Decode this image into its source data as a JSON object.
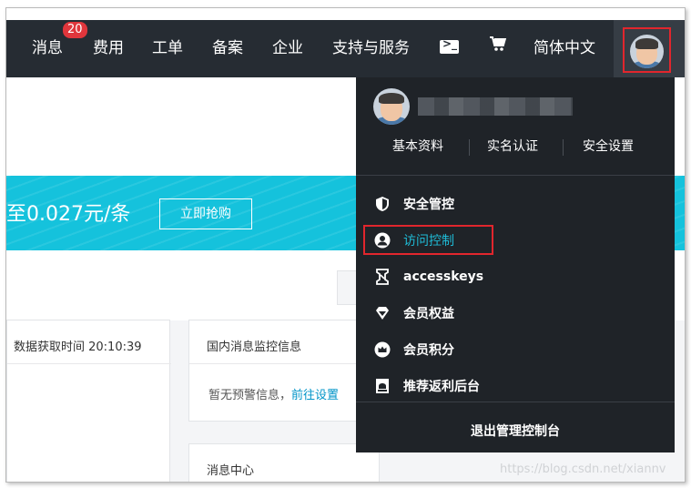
{
  "topnav": {
    "messages_label": "消息",
    "messages_badge": "20",
    "billing_label": "费用",
    "tickets_label": "工单",
    "icp_label": "备案",
    "enterprise_label": "企业",
    "support_label": "支持与服务",
    "language_label": "简体中文"
  },
  "page": {
    "banner_text": "至0.027元/条",
    "buy_button": "立即抢购",
    "data_time_label": "数据获取时间 20:10:39",
    "monitor_title": "国内消息监控信息",
    "monitor_empty": "暂无预警信息，",
    "monitor_link": "前往设置",
    "message_center_title": "消息中心"
  },
  "dropdown": {
    "links": [
      "基本资料",
      "实名认证",
      "安全设置"
    ],
    "items": [
      {
        "label": "安全管控",
        "icon": "shield-icon"
      },
      {
        "label": "访问控制",
        "icon": "user-circle-icon"
      },
      {
        "label": "accesskeys",
        "icon": "key-swap-icon"
      },
      {
        "label": "会员权益",
        "icon": "diamond-icon"
      },
      {
        "label": "会员积分",
        "icon": "crown-coin-icon"
      },
      {
        "label": "推荐返利后台",
        "icon": "document-icon"
      }
    ],
    "logout": "退出管理控制台"
  },
  "watermark": "https://blog.csdn.net/xiannv",
  "colors": {
    "topbar": "#262c33",
    "dropdown": "#1f2328",
    "accent": "#1fbbd6",
    "banner": "#15c2dc",
    "highlight": "#e1262d",
    "badge": "#e0363c"
  }
}
